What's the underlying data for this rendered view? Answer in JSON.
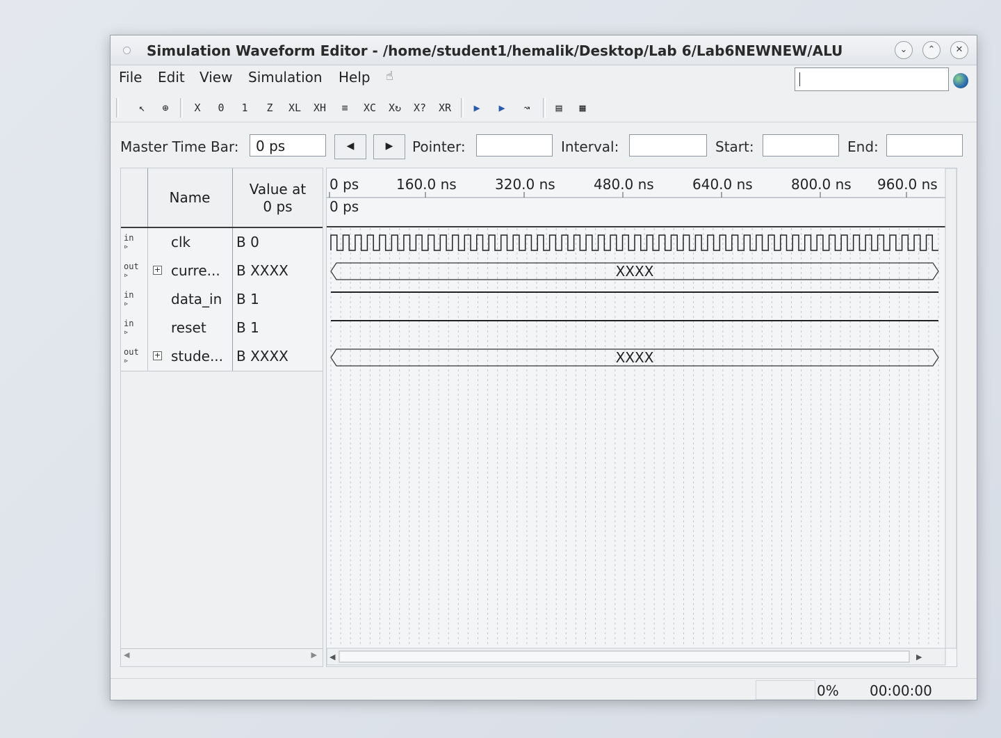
{
  "window": {
    "title": "Simulation Waveform Editor - /home/student1/hemalik/Desktop/Lab 6/Lab6NEWNEW/ALU"
  },
  "menu": {
    "items": [
      "File",
      "Edit",
      "View",
      "Simulation",
      "Help"
    ]
  },
  "timebar": {
    "master_label": "Master Time Bar:",
    "master_value": "0 ps",
    "pointer_label": "Pointer:",
    "pointer_value": "",
    "interval_label": "Interval:",
    "interval_value": "",
    "start_label": "Start:",
    "start_value": "",
    "end_label": "End:",
    "end_value": ""
  },
  "names": {
    "header_name": "Name",
    "header_value_1": "Value at",
    "header_value_2": "0 ps",
    "rows": [
      {
        "icon": "in",
        "name": "clk",
        "value": "B 0",
        "expandable": false
      },
      {
        "icon": "out",
        "name": "curre...",
        "value": "B XXXX",
        "expandable": true
      },
      {
        "icon": "in",
        "name": "data_in",
        "value": "B 1",
        "expandable": false
      },
      {
        "icon": "in",
        "name": "reset",
        "value": "B 1",
        "expandable": false
      },
      {
        "icon": "out",
        "name": "stude...",
        "value": "B XXXX",
        "expandable": true
      }
    ]
  },
  "timeline": {
    "ticks": [
      "0 ps",
      "160.0 ns",
      "320.0 ns",
      "480.0 ns",
      "640.0 ns",
      "800.0 ns",
      "960.0 ns"
    ],
    "cursor_label": "0 ps",
    "bus_value_current": "XXXX",
    "bus_value_student": "XXXX",
    "clk_cycles": 50
  },
  "status": {
    "progress": "0%",
    "elapsed": "00:00:00"
  }
}
